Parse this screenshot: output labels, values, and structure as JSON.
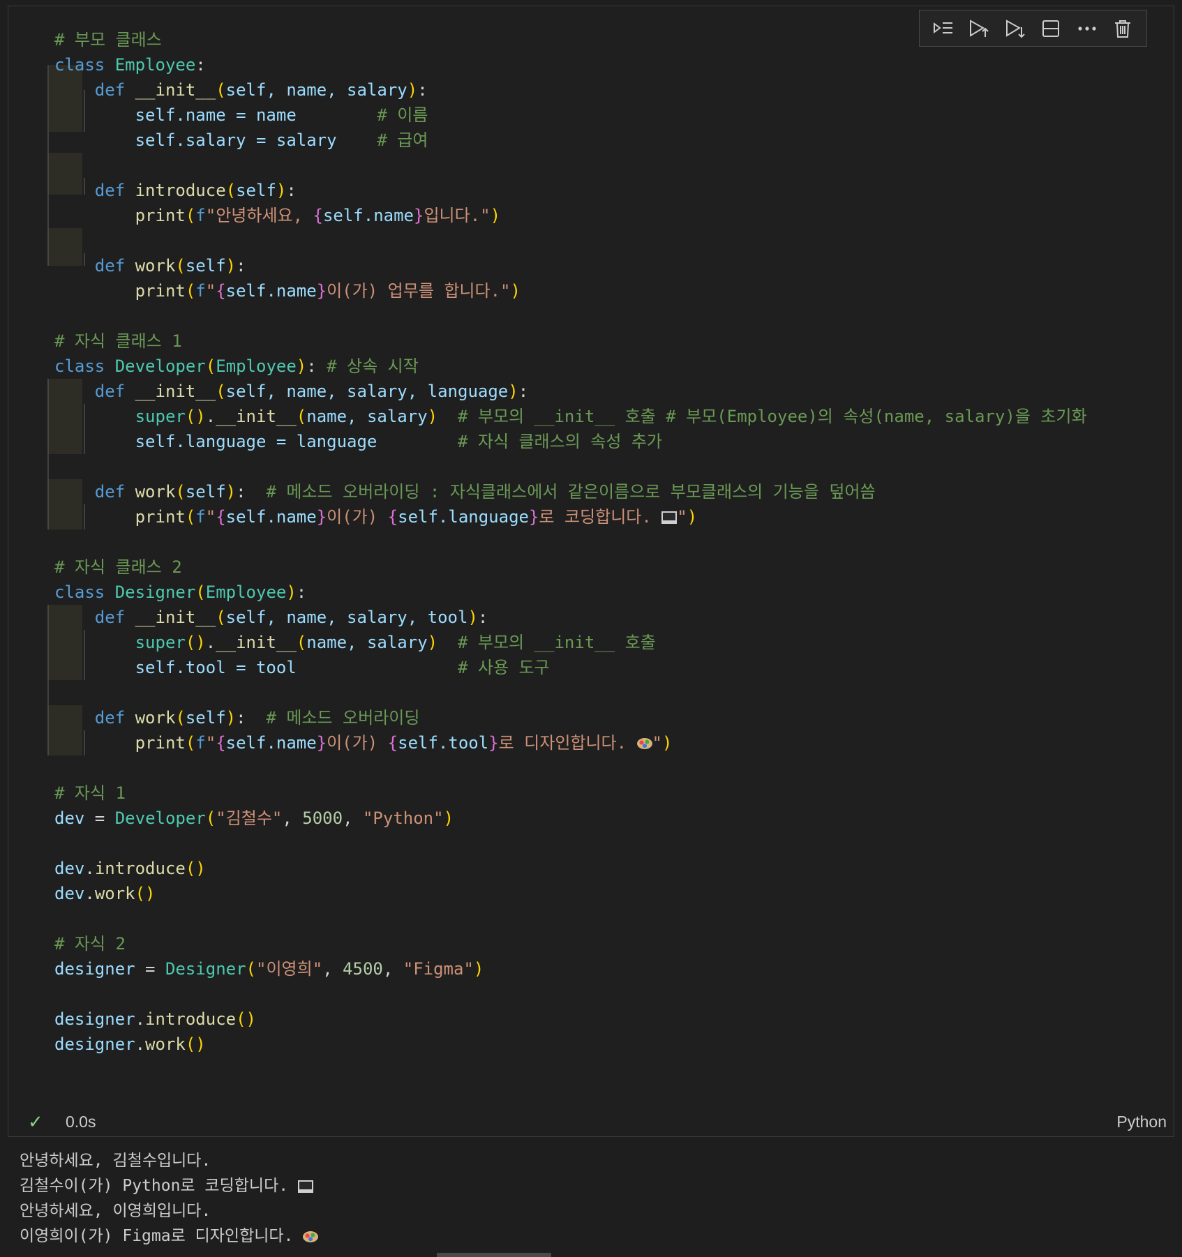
{
  "toolbar": {
    "icons": [
      "run-by-line-icon",
      "execute-above-icon",
      "execute-below-icon",
      "split-cell-icon",
      "more-actions-icon",
      "delete-cell-icon"
    ]
  },
  "code": {
    "c_parent": "# 부모 클래스",
    "l1_kw": "class",
    "l1_name": "Employee",
    "l2_kw": "def",
    "l2_fn": "__init__",
    "l2_params": "self, name, salary",
    "l3_a": "self.name = name",
    "l3_cmt": "# 이름",
    "l4_a": "self.salary = salary",
    "l4_cmt": "# 급여",
    "l6_fn": "introduce",
    "self": "self",
    "print": "print",
    "f": "f",
    "l7_s1": "\"안녕하세요, ",
    "l7_i": "self.name",
    "l7_s2": "입니다.\"",
    "l9_fn": "work",
    "l10_s2": "이(가) 업무를 합니다.\"",
    "quote": "\"",
    "c_child1": "# 자식 클래스 1",
    "dev_cls": "Developer",
    "base": "Employee",
    "dev_cmt": "# 상속 시작",
    "dev_init_params": "self, name, salary, language",
    "super": "super",
    "init": "__init__",
    "super_args": "name, salary",
    "dev_super_cmt": "# 부모의 __init__ 호출 # 부모(Employee)의 속성(name, salary)을 초기화",
    "dev_lang_line": "self.language = language",
    "dev_lang_cmt": "# 자식 클래스의 속성 추가",
    "dev_work_cmt": "# 메소드 오버라이딩 : 자식클래스에서 같은이름으로 부모클래스의 기능을 덮어씀",
    "mid": "이(가) ",
    "dev_i2": "self.language",
    "dev_s3": "로 코딩합니다. ",
    "c_child2": "# 자식 클래스 2",
    "des_cls": "Designer",
    "des_init_params": "self, name, salary, tool",
    "des_super_cmt": "# 부모의 __init__ 호출",
    "des_tool_line": "self.tool = tool",
    "des_tool_cmt": "# 사용 도구",
    "des_work_cmt": "# 메소드 오버라이딩",
    "des_i2": "self.tool",
    "des_s3": "로 디자인합니다. ",
    "c_inst1": "# 자식 1",
    "dev_var": "dev",
    "dev_a1": "\"김철수\"",
    "dev_a2": "5000",
    "dev_a3": "\"Python\"",
    "c_inst2": "# 자식 2",
    "des_var": "designer",
    "des_a1": "\"이영희\"",
    "des_a2": "4500",
    "des_a3": "\"Figma\""
  },
  "status": {
    "check": "✓",
    "time": "0.0s",
    "language": "Python"
  },
  "output": {
    "l1": "안녕하세요, 김철수입니다.",
    "l2": "김철수이(가) Python로 코딩합니다. ",
    "l3": "안녕하세요, 이영희입니다.",
    "l4": "이영희이(가) Figma로 디자인합니다. "
  }
}
